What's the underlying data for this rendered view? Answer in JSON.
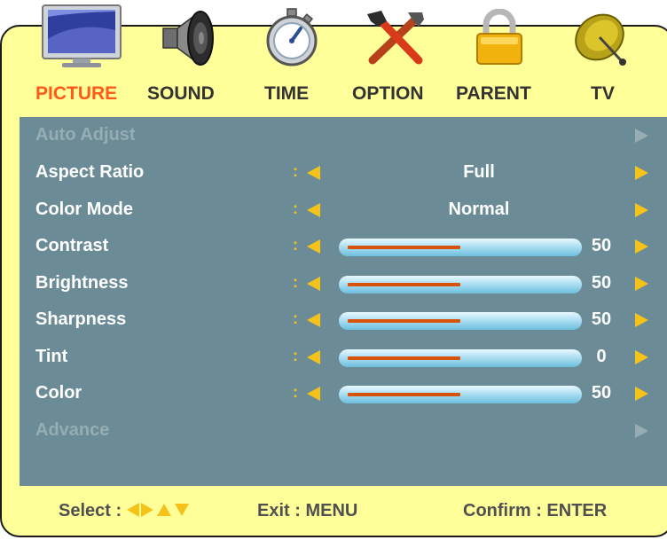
{
  "tabs": [
    {
      "label": "PICTURE",
      "icon": "monitor-icon",
      "active": true
    },
    {
      "label": "SOUND",
      "icon": "speaker-icon",
      "active": false
    },
    {
      "label": "TIME",
      "icon": "stopwatch-icon",
      "active": false
    },
    {
      "label": "OPTION",
      "icon": "tools-icon",
      "active": false
    },
    {
      "label": "PARENT",
      "icon": "lock-icon",
      "active": false
    },
    {
      "label": "TV",
      "icon": "satellite-dish-icon",
      "active": false
    }
  ],
  "menu": {
    "auto_adjust": {
      "label": "Auto Adjust",
      "enabled": false
    },
    "aspect_ratio": {
      "label": "Aspect Ratio",
      "separator": ":",
      "value": "Full"
    },
    "color_mode": {
      "label": "Color Mode",
      "separator": ":",
      "value": "Normal"
    },
    "contrast": {
      "label": "Contrast",
      "separator": ":",
      "value": "50",
      "level": 50
    },
    "brightness": {
      "label": "Brightness",
      "separator": ":",
      "value": "50",
      "level": 50
    },
    "sharpness": {
      "label": "Sharpness",
      "separator": ":",
      "value": "50",
      "level": 50
    },
    "tint": {
      "label": "Tint",
      "separator": ":",
      "value": "0",
      "level": 50
    },
    "color": {
      "label": "Color",
      "separator": ":",
      "value": "50",
      "level": 50
    },
    "advance": {
      "label": "Advance",
      "enabled": false
    }
  },
  "footer": {
    "select_label": "Select :",
    "exit_label": "Exit : MENU",
    "confirm_label": "Confirm : ENTER"
  },
  "colors": {
    "panel_bg": "#ffff99",
    "menu_bg": "#6b8c96",
    "accent_arrow": "#f5c21a",
    "active_tab": "#ff5a1a",
    "slider_fill": "#d9520a"
  }
}
